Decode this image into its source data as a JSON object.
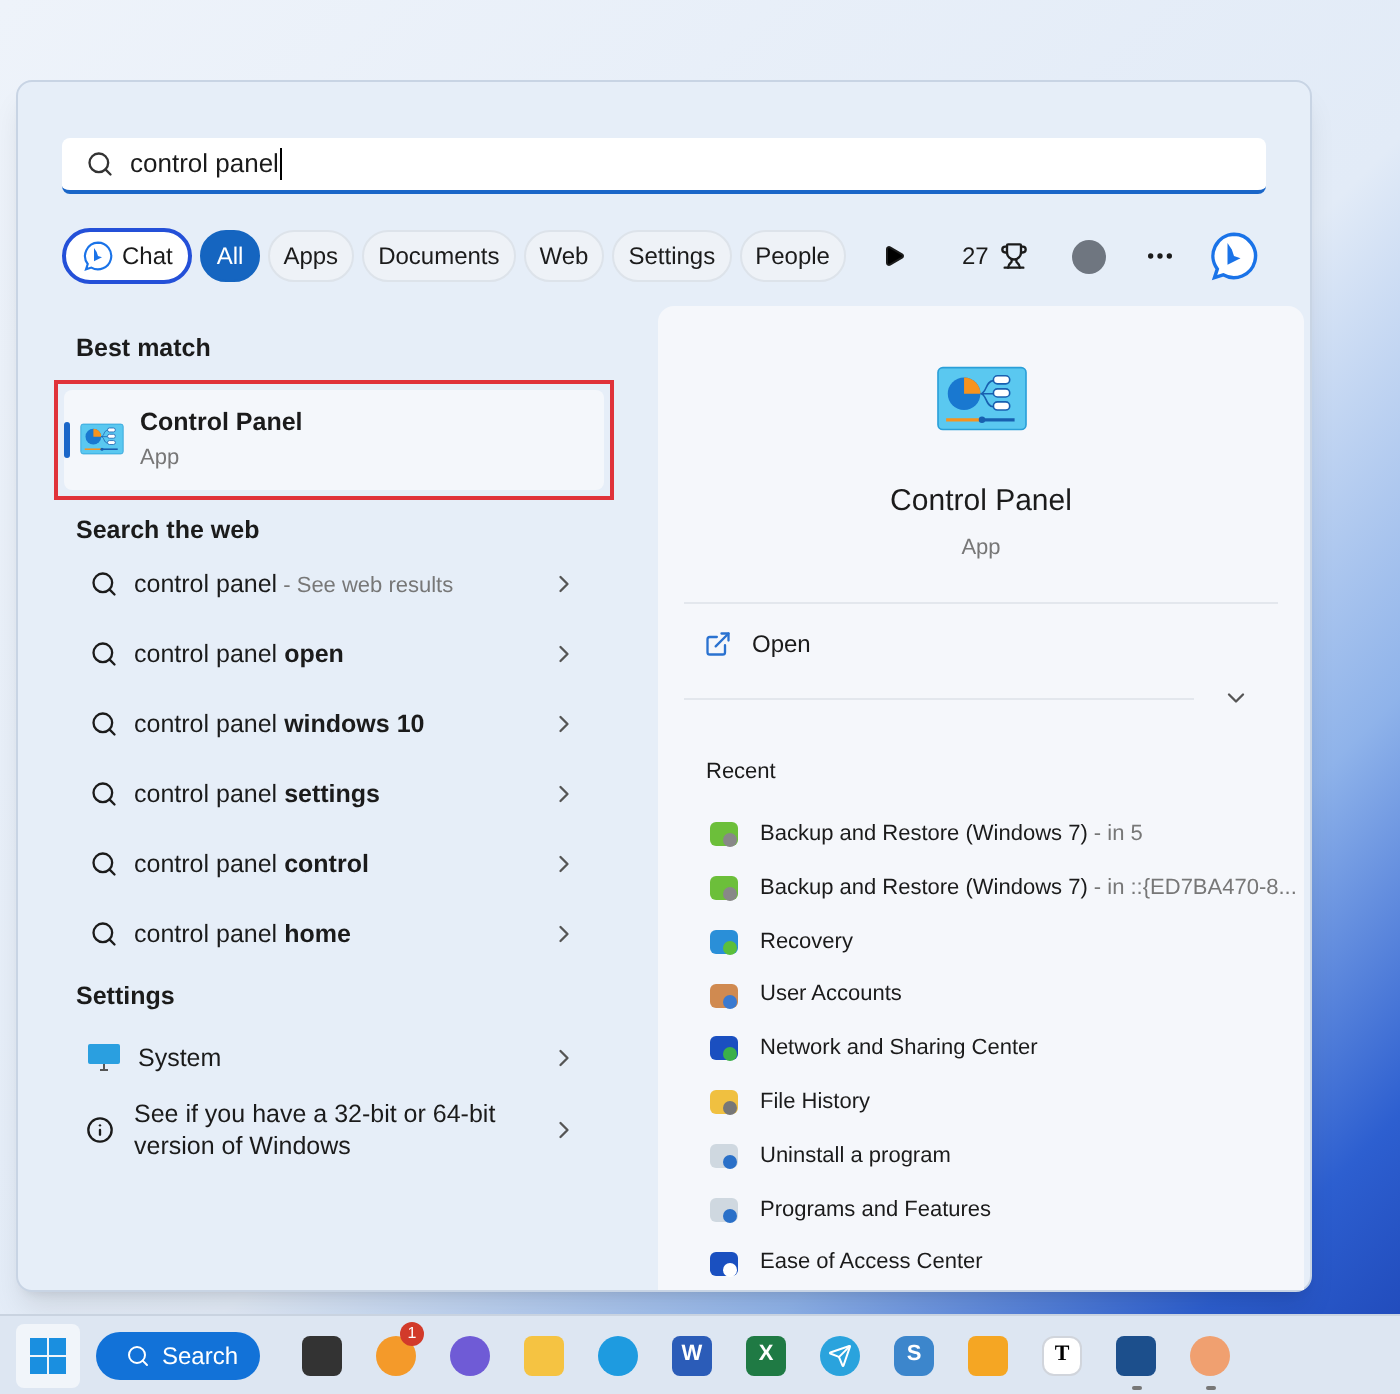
{
  "search": {
    "value": "control panel"
  },
  "filters": [
    {
      "label": "Chat",
      "kind": "chat",
      "selected": false
    },
    {
      "label": "All",
      "kind": "tab",
      "selected": true
    },
    {
      "label": "Apps",
      "kind": "tab",
      "selected": false
    },
    {
      "label": "Documents",
      "kind": "tab",
      "selected": false
    },
    {
      "label": "Web",
      "kind": "tab",
      "selected": false
    },
    {
      "label": "Settings",
      "kind": "tab",
      "selected": false
    },
    {
      "label": "People",
      "kind": "tab",
      "selected": false
    }
  ],
  "points": "27",
  "best_match": {
    "heading": "Best match",
    "name": "Control Panel",
    "type": "App",
    "selected": true
  },
  "web": {
    "heading": "Search the web",
    "items": [
      {
        "query": "control panel",
        "hint": " - See web results"
      },
      {
        "query": "control panel **open**"
      },
      {
        "query": "control panel **windows 10**"
      },
      {
        "query": "control panel **settings**"
      },
      {
        "query": "control panel **control**"
      },
      {
        "query": "control panel **home**"
      }
    ]
  },
  "settings": {
    "heading": "Settings",
    "items": [
      {
        "kind": "system",
        "label": "System"
      },
      {
        "kind": "info",
        "label": "See if you have a 32-bit or 64-bit version of Windows"
      }
    ]
  },
  "preview": {
    "name": "Control Panel",
    "type": "App",
    "action": "Open",
    "recent_heading": "Recent",
    "recent": [
      {
        "kind": "backup",
        "name": "Backup and Restore (Windows 7)",
        "detail": " - in 5"
      },
      {
        "kind": "backup",
        "name": "Backup and Restore (Windows 7)",
        "detail": " - in ::{ED7BA470-8..."
      },
      {
        "kind": "recovery",
        "name": "Recovery"
      },
      {
        "kind": "users",
        "name": "User Accounts"
      },
      {
        "kind": "network",
        "name": "Network and Sharing Center"
      },
      {
        "kind": "history",
        "name": "File History"
      },
      {
        "kind": "programs",
        "name": "Uninstall a program"
      },
      {
        "kind": "programs",
        "name": "Programs and Features"
      },
      {
        "kind": "access",
        "name": "Ease of Access Center"
      }
    ]
  },
  "taskbar": {
    "search": "Search",
    "apps": [
      {
        "kind": "taskview",
        "running": false
      },
      {
        "kind": "weather",
        "badge": "1",
        "running": false
      },
      {
        "kind": "meet",
        "running": false
      },
      {
        "kind": "folder",
        "running": false
      },
      {
        "kind": "browser",
        "running": false
      },
      {
        "kind": "word",
        "label": "W",
        "running": false
      },
      {
        "kind": "excel",
        "label": "X",
        "running": false
      },
      {
        "kind": "telegram",
        "running": false
      },
      {
        "kind": "sapp",
        "label": "S",
        "running": false
      },
      {
        "kind": "squares",
        "running": false
      },
      {
        "kind": "typora",
        "label": "T",
        "running": false
      },
      {
        "kind": "store",
        "running": true
      },
      {
        "kind": "person",
        "running": true
      }
    ]
  }
}
